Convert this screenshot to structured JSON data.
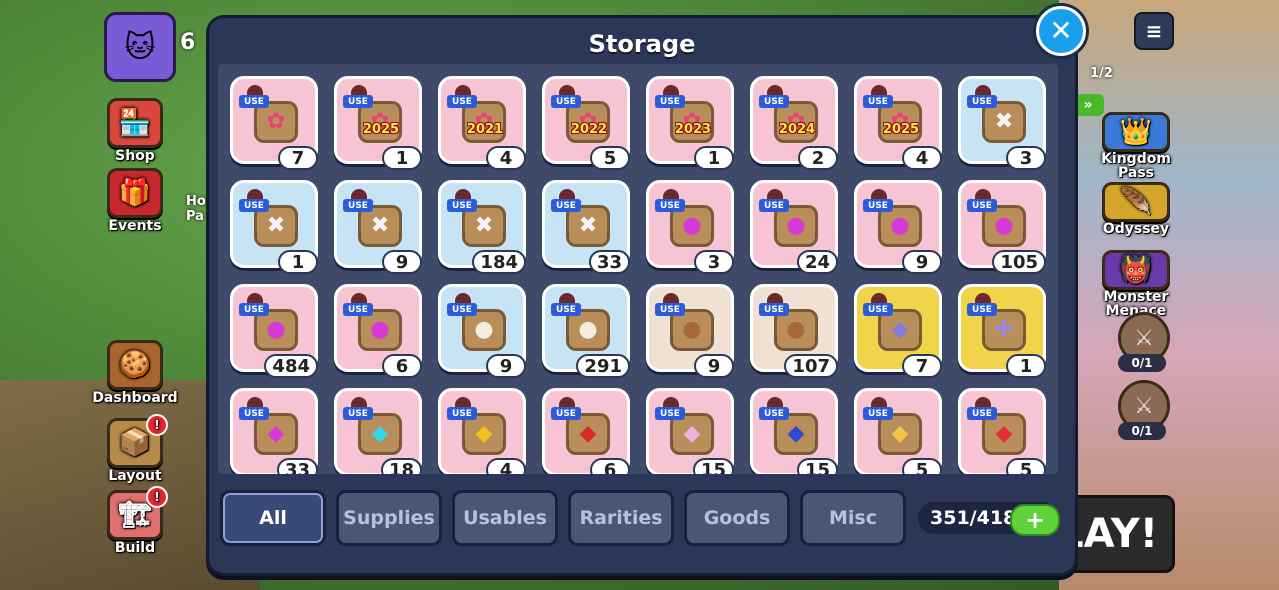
{
  "background": {
    "left_menu": [
      {
        "label": "Shop",
        "icon": "shop-icon",
        "glyph": "🏪",
        "color": "#d9483b"
      },
      {
        "label": "Events",
        "icon": "gift-icon",
        "glyph": "🎁",
        "color": "#c8282e"
      },
      {
        "label": "Dashboard",
        "icon": "dashboard-icon",
        "glyph": "🍪",
        "color": "#a8662e"
      },
      {
        "label": "Layout",
        "icon": "layout-icon",
        "glyph": "📦",
        "color": "#b88a4a",
        "badge": "!"
      },
      {
        "label": "Build",
        "icon": "build-icon",
        "glyph": "🏗",
        "color": "#e07070",
        "badge": "!"
      }
    ],
    "partial_label": "Ho\nPa",
    "currency_partial": "6",
    "right_menu": [
      {
        "label": "Kingdom\nPass",
        "icon": "kingdom-pass-icon",
        "glyph": "👑",
        "color": "#3a7ad6"
      },
      {
        "label": "Odyssey",
        "icon": "odyssey-icon",
        "glyph": "🪶",
        "color": "#d6a62a"
      },
      {
        "label": "Monster\nMenace",
        "icon": "monster-icon",
        "glyph": "👹",
        "color": "#6a3aa8"
      }
    ],
    "quest_progress": "1/2",
    "quests": [
      {
        "count": "0/1"
      },
      {
        "count": "0/1"
      }
    ],
    "play_label": "LAY!"
  },
  "storage": {
    "title": "Storage",
    "items": [
      {
        "bg": "pink",
        "glyph": "✿",
        "glyph_color": "#e8407a",
        "year": "",
        "qty": "7"
      },
      {
        "bg": "pink",
        "glyph": "✿",
        "glyph_color": "#e8407a",
        "year": "2025",
        "qty": "1"
      },
      {
        "bg": "pink",
        "glyph": "✿",
        "glyph_color": "#e8407a",
        "year": "2021",
        "qty": "4"
      },
      {
        "bg": "pink",
        "glyph": "✿",
        "glyph_color": "#e8407a",
        "year": "2022",
        "qty": "5"
      },
      {
        "bg": "pink",
        "glyph": "✿",
        "glyph_color": "#e8407a",
        "year": "2023",
        "qty": "1"
      },
      {
        "bg": "pink",
        "glyph": "✿",
        "glyph_color": "#e8407a",
        "year": "2024",
        "qty": "2"
      },
      {
        "bg": "pink",
        "glyph": "✿",
        "glyph_color": "#e8407a",
        "year": "2025",
        "qty": "4"
      },
      {
        "bg": "blue",
        "glyph": "✖",
        "glyph_color": "#f4f4f4",
        "year": "",
        "qty": "3"
      },
      {
        "bg": "blue",
        "glyph": "✖",
        "glyph_color": "#f4f4f4",
        "year": "",
        "qty": "1"
      },
      {
        "bg": "blue",
        "glyph": "✖",
        "glyph_color": "#f4f4f4",
        "year": "",
        "qty": "9"
      },
      {
        "bg": "blue",
        "glyph": "✖",
        "glyph_color": "#f4f4f4",
        "year": "",
        "qty": "184"
      },
      {
        "bg": "blue",
        "glyph": "✖",
        "glyph_color": "#f4f4f4",
        "year": "",
        "qty": "33"
      },
      {
        "bg": "pink",
        "glyph": "●",
        "glyph_color": "#d63ad6",
        "year": "",
        "qty": "3"
      },
      {
        "bg": "pink",
        "glyph": "●",
        "glyph_color": "#d63ad6",
        "year": "",
        "qty": "24"
      },
      {
        "bg": "pink",
        "glyph": "●",
        "glyph_color": "#d63ad6",
        "year": "",
        "qty": "9"
      },
      {
        "bg": "pink",
        "glyph": "●",
        "glyph_color": "#d63ad6",
        "year": "",
        "qty": "105"
      },
      {
        "bg": "pink",
        "glyph": "●",
        "glyph_color": "#d63ad6",
        "year": "",
        "qty": "484"
      },
      {
        "bg": "pink",
        "glyph": "●",
        "glyph_color": "#d63ad6",
        "year": "",
        "qty": "6"
      },
      {
        "bg": "blue",
        "glyph": "●",
        "glyph_color": "#f2efe0",
        "year": "",
        "qty": "9"
      },
      {
        "bg": "blue",
        "glyph": "●",
        "glyph_color": "#f2efe0",
        "year": "",
        "qty": "291"
      },
      {
        "bg": "beige",
        "glyph": "●",
        "glyph_color": "#a8683a",
        "year": "",
        "qty": "9"
      },
      {
        "bg": "beige",
        "glyph": "●",
        "glyph_color": "#a8683a",
        "year": "",
        "qty": "107"
      },
      {
        "bg": "gold",
        "glyph": "◆",
        "glyph_color": "#8a7ad8",
        "year": "",
        "qty": "7"
      },
      {
        "bg": "gold",
        "glyph": "✚",
        "glyph_color": "#9a8ae0",
        "year": "",
        "qty": "1"
      },
      {
        "bg": "pink",
        "glyph": "◆",
        "glyph_color": "#d63ad6",
        "year": "",
        "qty": "33"
      },
      {
        "bg": "pink",
        "glyph": "◆",
        "glyph_color": "#3ad6e0",
        "year": "",
        "qty": "18"
      },
      {
        "bg": "pink",
        "glyph": "◆",
        "glyph_color": "#f2c21a",
        "year": "",
        "qty": "4"
      },
      {
        "bg": "pink",
        "glyph": "◆",
        "glyph_color": "#d62a2a",
        "year": "",
        "qty": "6"
      },
      {
        "bg": "pink",
        "glyph": "◆",
        "glyph_color": "#f2b0e0",
        "year": "",
        "qty": "15"
      },
      {
        "bg": "pink",
        "glyph": "◆",
        "glyph_color": "#2a4ad6",
        "year": "",
        "qty": "15"
      },
      {
        "bg": "pink",
        "glyph": "◆",
        "glyph_color": "#f2c24a",
        "year": "",
        "qty": "5"
      },
      {
        "bg": "pink",
        "glyph": "◆",
        "glyph_color": "#e0303a",
        "year": "",
        "qty": "5"
      }
    ],
    "use_label": "USE",
    "tabs": [
      {
        "label": "All",
        "active": true
      },
      {
        "label": "Supplies",
        "active": false
      },
      {
        "label": "Usables",
        "active": false
      },
      {
        "label": "Rarities",
        "active": false
      },
      {
        "label": "Goods",
        "active": false
      },
      {
        "label": "Misc",
        "active": false
      }
    ],
    "capacity": "351/418",
    "add_label": "+",
    "close_label": "✕"
  }
}
